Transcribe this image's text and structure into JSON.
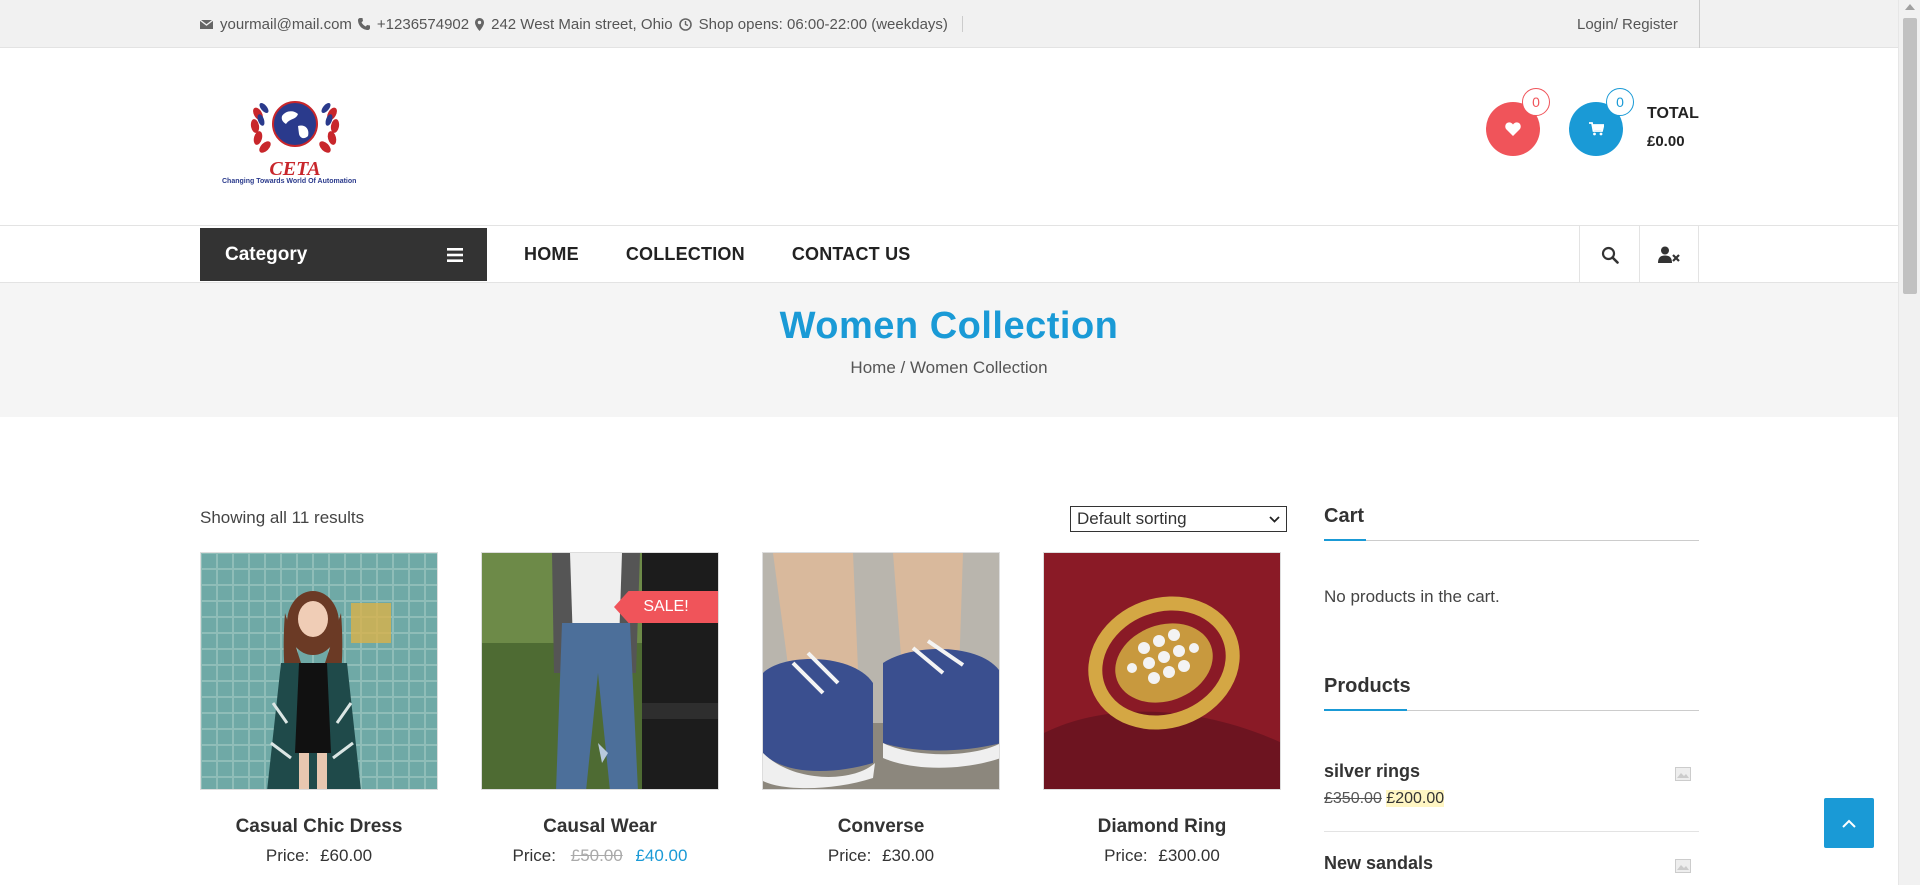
{
  "topbar": {
    "email": "yourmail@mail.com",
    "phone": "+1236574902",
    "address": "242 West Main street, Ohio",
    "hours": "Shop opens: 06:00-22:00 (weekdays)",
    "login": "Login/ Register"
  },
  "header": {
    "logo_text": "CETA",
    "logo_caption": "Changing Towards World Of Automation",
    "wishlist_count": "0",
    "cart_count": "0",
    "total_label": "TOTAL",
    "total_value": "£0.00"
  },
  "nav": {
    "category_label": "Category",
    "menu": [
      "HOME",
      "COLLECTION",
      "CONTACT US"
    ]
  },
  "page": {
    "title": "Women Collection",
    "breadcrumb": "Home / Women Collection"
  },
  "shop": {
    "result_count": "Showing all 11 results",
    "sorting": "Default sorting",
    "sale_label": "SALE!",
    "price_prefix": "Price:",
    "products": [
      {
        "name": "Casual Chic Dress",
        "price": "£60.00"
      },
      {
        "name": "Causal Wear",
        "old_price": "£50.00",
        "price": "£40.00"
      },
      {
        "name": "Converse",
        "price": "£30.00"
      },
      {
        "name": "Diamond Ring",
        "price": "£300.00"
      }
    ]
  },
  "sidebar": {
    "cart_title": "Cart",
    "cart_empty": "No products in the cart.",
    "products_title": "Products",
    "products": [
      {
        "name": "silver rings",
        "old_price": "£350.00",
        "price": "£200.00"
      },
      {
        "name": "New sandals"
      }
    ]
  },
  "colors": {
    "accent": "#1a9ad6",
    "sale": "#f0545a",
    "nav_dark": "#333333"
  }
}
